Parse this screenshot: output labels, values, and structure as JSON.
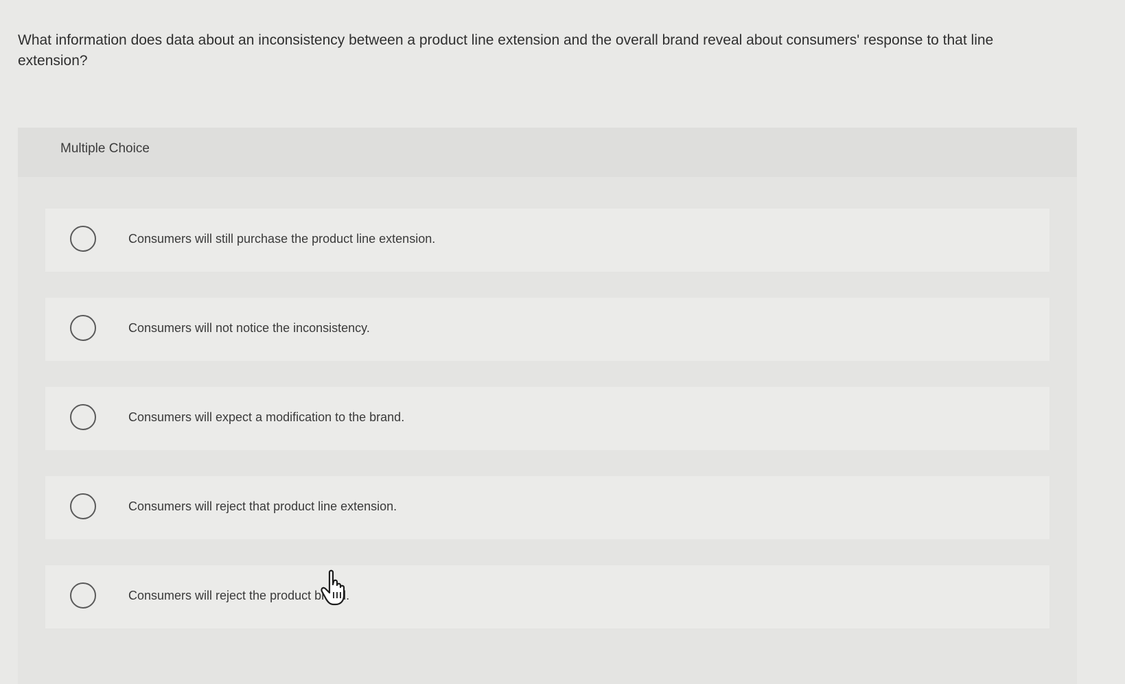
{
  "question": {
    "text": "What information does data about an inconsistency between a product line extension and the overall brand reveal about consumers' response to that line extension?"
  },
  "panel": {
    "title": "Multiple Choice"
  },
  "options": [
    {
      "label": "Consumers will still purchase the product line extension."
    },
    {
      "label": "Consumers will not notice the inconsistency."
    },
    {
      "label": "Consumers will expect a modification to the brand."
    },
    {
      "label": "Consumers will reject that product line extension."
    },
    {
      "label": "Consumers will reject the product brand."
    }
  ],
  "icons": {
    "cursor": "hand-pointer-icon"
  }
}
